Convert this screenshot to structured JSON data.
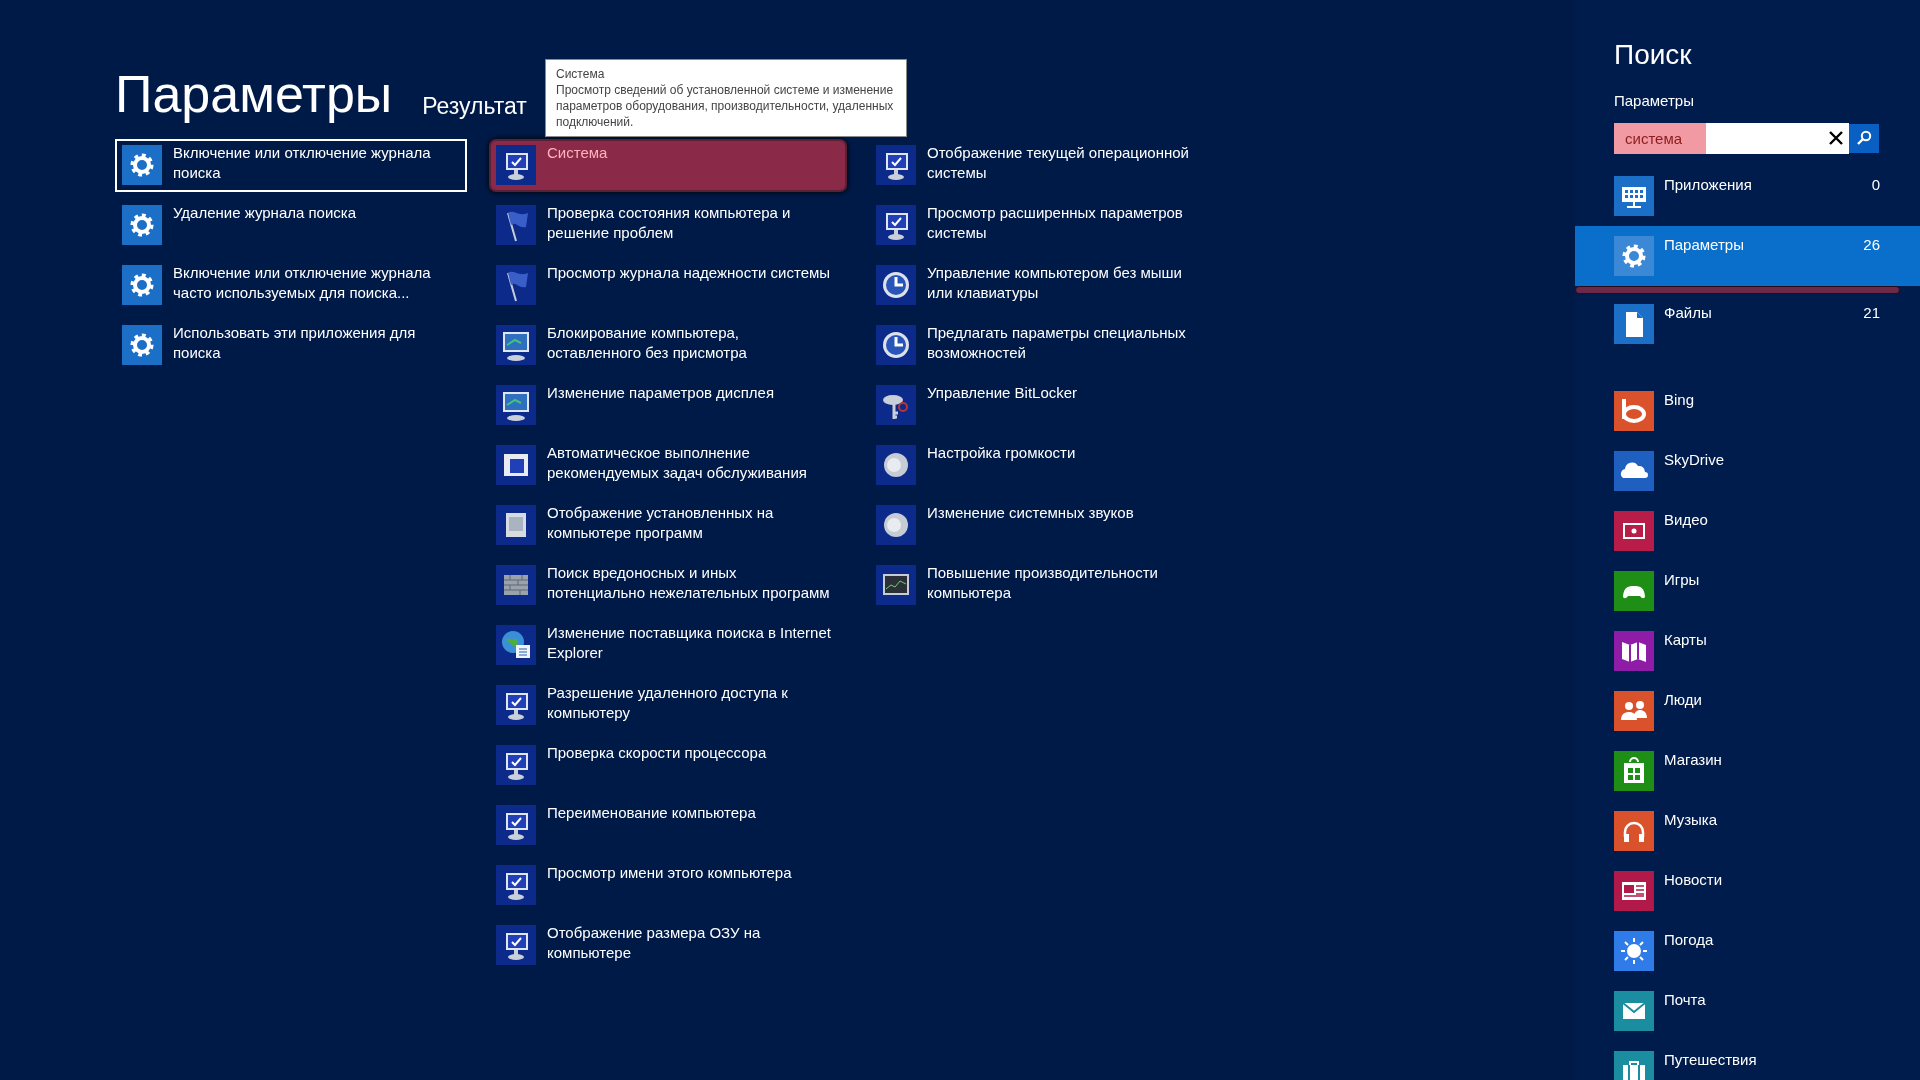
{
  "header": {
    "title": "Параметры",
    "subtitle": "Результат"
  },
  "tooltip": {
    "title": "Система",
    "text": "Просмотр сведений об установленной системе и изменение параметров оборудования, производительности, удаленных подключений."
  },
  "columns": [
    [
      {
        "label": "Включение или отключение журнала поиска",
        "kind": "gear",
        "selected": true,
        "highlighted": false
      },
      {
        "label": "Удаление журнала поиска",
        "kind": "gear",
        "selected": false,
        "highlighted": false
      },
      {
        "label": "Включение или отключение журнала часто используемых для поиска...",
        "kind": "gear",
        "selected": false,
        "highlighted": false
      },
      {
        "label": "Использовать эти приложения для поиска",
        "kind": "gear",
        "selected": false,
        "highlighted": false
      }
    ],
    [
      {
        "label": "Система",
        "kind": "monitor",
        "selected": false,
        "highlighted": true
      },
      {
        "label": "Проверка состояния компьютера и решение проблем",
        "kind": "flag",
        "selected": false,
        "highlighted": false
      },
      {
        "label": "Просмотр журнала надежности системы",
        "kind": "flag",
        "selected": false,
        "highlighted": false
      },
      {
        "label": "Блокирование компьютера, оставленного без присмотра",
        "kind": "display",
        "selected": false,
        "highlighted": false
      },
      {
        "label": "Изменение параметров дисплея",
        "kind": "display",
        "selected": false,
        "highlighted": false
      },
      {
        "label": "Автоматическое выполнение рекомендуемых задач обслуживания",
        "kind": "window",
        "selected": false,
        "highlighted": false
      },
      {
        "label": "Отображение установленных на компьютере программ",
        "kind": "programs",
        "selected": false,
        "highlighted": false
      },
      {
        "label": "Поиск вредоносных и иных потенциально нежелательных программ",
        "kind": "wall",
        "selected": false,
        "highlighted": false
      },
      {
        "label": "Изменение поставщика поиска в Internet Explorer",
        "kind": "globe",
        "selected": false,
        "highlighted": false
      },
      {
        "label": "Разрешение удаленного доступа к компьютеру",
        "kind": "monitor",
        "selected": false,
        "highlighted": false
      },
      {
        "label": "Проверка скорости процессора",
        "kind": "monitor",
        "selected": false,
        "highlighted": false
      },
      {
        "label": "Переименование компьютера",
        "kind": "monitor",
        "selected": false,
        "highlighted": false
      },
      {
        "label": "Просмотр имени этого компьютера",
        "kind": "monitor",
        "selected": false,
        "highlighted": false
      },
      {
        "label": "Отображение размера ОЗУ на компьютере",
        "kind": "monitor",
        "selected": false,
        "highlighted": false
      }
    ],
    [
      {
        "label": "Отображение текущей операционной системы",
        "kind": "monitor",
        "selected": false,
        "highlighted": false
      },
      {
        "label": "Просмотр расширенных параметров системы",
        "kind": "monitor",
        "selected": false,
        "highlighted": false
      },
      {
        "label": "Управление компьютером без мыши или клавиатуры",
        "kind": "access",
        "selected": false,
        "highlighted": false
      },
      {
        "label": "Предлагать параметры специальных возможностей",
        "kind": "access",
        "selected": false,
        "highlighted": false
      },
      {
        "label": "Управление BitLocker",
        "kind": "key",
        "selected": false,
        "highlighted": false
      },
      {
        "label": "Настройка громкости",
        "kind": "speaker",
        "selected": false,
        "highlighted": false
      },
      {
        "label": "Изменение системных звуков",
        "kind": "speaker",
        "selected": false,
        "highlighted": false
      },
      {
        "label": "Повышение производительности компьютера",
        "kind": "meter",
        "selected": false,
        "highlighted": false
      }
    ]
  ],
  "sidebar": {
    "title": "Поиск",
    "scope": "Параметры",
    "search": {
      "value": "система",
      "highlighted": true
    },
    "categories": [
      {
        "label": "Приложения",
        "count": "0",
        "kind": "apps",
        "selected": false,
        "highlighted": false
      },
      {
        "label": "Параметры",
        "count": "26",
        "kind": "settings",
        "selected": true,
        "highlighted": true
      },
      {
        "label": "Файлы",
        "count": "21",
        "kind": "file",
        "selected": false,
        "highlighted": false
      }
    ],
    "apps": [
      {
        "label": "Bing",
        "kind": "bing",
        "color": "#d9522b"
      },
      {
        "label": "SkyDrive",
        "kind": "cloud",
        "color": "#1f5fc0"
      },
      {
        "label": "Видео",
        "kind": "video",
        "color": "#b81d4a"
      },
      {
        "label": "Игры",
        "kind": "gamepad",
        "color": "#1e8e16"
      },
      {
        "label": "Карты",
        "kind": "map",
        "color": "#8e1ca7"
      },
      {
        "label": "Люди",
        "kind": "people",
        "color": "#d9522b"
      },
      {
        "label": "Магазин",
        "kind": "store",
        "color": "#1e8e16"
      },
      {
        "label": "Музыка",
        "kind": "headphones",
        "color": "#d9522b"
      },
      {
        "label": "Новости",
        "kind": "news",
        "color": "#b0194a"
      },
      {
        "label": "Погода",
        "kind": "sun",
        "color": "#2f7ce8"
      },
      {
        "label": "Почта",
        "kind": "mail",
        "color": "#1a8ea0"
      },
      {
        "label": "Путешествия",
        "kind": "suitcase",
        "color": "#1a8ea0"
      }
    ]
  }
}
